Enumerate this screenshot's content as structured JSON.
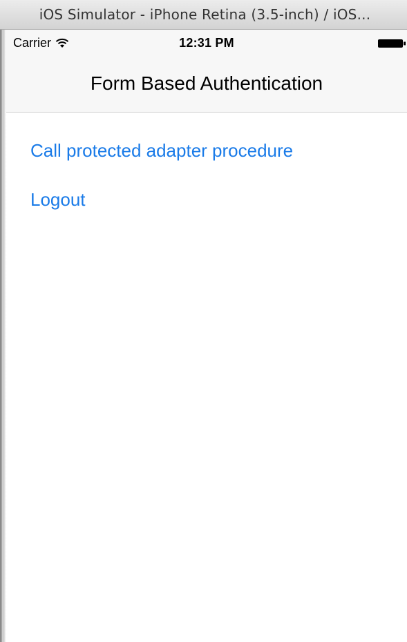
{
  "window": {
    "title": "iOS Simulator - iPhone Retina (3.5-inch) / iOS..."
  },
  "status_bar": {
    "carrier": "Carrier",
    "time": "12:31 PM",
    "wifi_icon": "wifi-icon",
    "battery_icon": "battery-icon"
  },
  "nav": {
    "title": "Form Based Authentication"
  },
  "actions": {
    "call_procedure_label": "Call protected adapter procedure",
    "logout_label": "Logout"
  },
  "colors": {
    "link": "#1a7be8",
    "nav_background": "#f7f7f7"
  }
}
